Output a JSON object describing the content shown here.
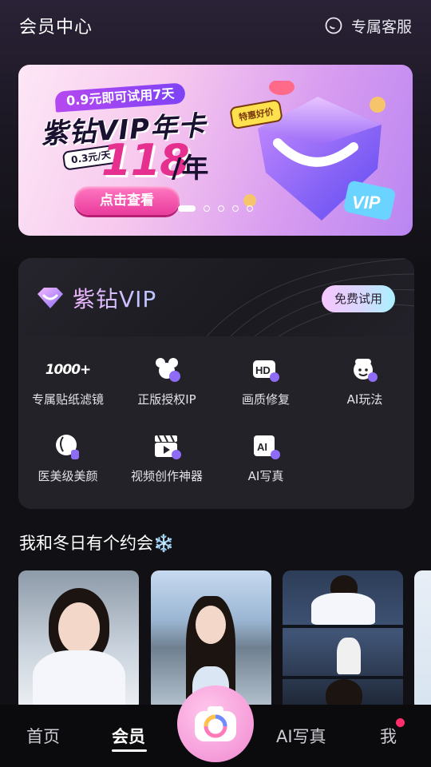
{
  "header": {
    "title": "会员中心",
    "service_label": "专属客服",
    "service_icon": "chat-bubble-icon"
  },
  "banner": {
    "subtitle": "0.9元即可试用7天",
    "title": "紫钻VIP年卡",
    "per_day": "0.3元/天",
    "price": "118",
    "price_unit": "/年",
    "tag": "特惠好价",
    "cta": "点击查看",
    "gem_label": "VIP",
    "pages": 5,
    "active_page": 1
  },
  "vip": {
    "name": "紫钻VIP",
    "trial_label": "免费试用",
    "features": [
      {
        "label": "专属贴纸滤镜",
        "icon": "1000+",
        "icon_name": "sticker-count-icon"
      },
      {
        "label": "正版授权IP",
        "icon_name": "mouse-ears-icon"
      },
      {
        "label": "画质修复",
        "icon_name": "hd-icon"
      },
      {
        "label": "AI玩法",
        "icon_name": "ai-face-icon"
      },
      {
        "label": "医美级美颜",
        "icon_name": "beauty-face-icon"
      },
      {
        "label": "视频创作神器",
        "icon_name": "clapperboard-icon"
      },
      {
        "label": "AI写真",
        "icon_name": "ai-portrait-icon"
      }
    ]
  },
  "section": {
    "title": "我和冬日有个约会❄️"
  },
  "tabbar": {
    "items": [
      "首页",
      "会员",
      "AI写真",
      "我"
    ],
    "active": "会员",
    "center_icon": "camera-icon",
    "notification_dot_color": "#ff2d6b"
  },
  "colors": {
    "accent_pink": "#e6308f",
    "background": "#111014",
    "card": "#232228"
  }
}
